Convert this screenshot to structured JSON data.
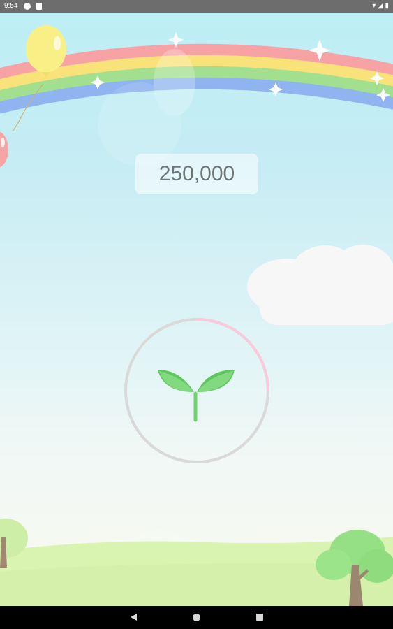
{
  "status_bar": {
    "time": "9:54",
    "right_icons": "▾ ◢ ▮"
  },
  "game": {
    "score": "250,000",
    "center_icon": "sprout-icon"
  },
  "colors": {
    "rainbow": [
      "#f7a3a6",
      "#f9e27a",
      "#a2e08f",
      "#8fb4f0"
    ],
    "progress_ring": "#fbc8dc",
    "ring_track": "#d9d9d9",
    "sprout": "#6fd26f",
    "ground": "#d9f3b1"
  },
  "navigation": {
    "back_icon": "back-triangle-icon",
    "home_icon": "home-circle-icon",
    "recents_icon": "recents-square-icon"
  }
}
